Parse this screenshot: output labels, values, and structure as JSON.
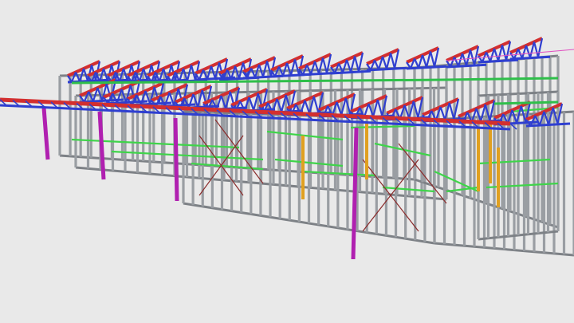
{
  "scene": {
    "background": "#e9e9e9",
    "colors": {
      "wall_frame": "#9a9ea3",
      "wall_frame_dark": "#7d8186",
      "top_chord": "#d32f2f",
      "web_member": "#2f3fd0",
      "bottom_chord_green": "#2fbf4a",
      "noggin_green": "#3fd44a",
      "post_magenta": "#b020b0",
      "post_orange": "#e0a020",
      "brace_red": "#8a2a2a",
      "ridge_pink": "#e050c0"
    },
    "icons": [
      "steel-frame-wall",
      "roof-truss",
      "verandah-post",
      "cross-brace"
    ]
  }
}
